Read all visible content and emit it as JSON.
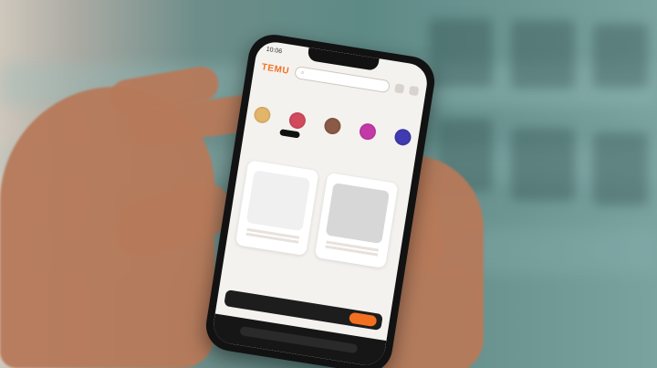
{
  "phone": {
    "status_time": "10:06",
    "header": {
      "logo_text": "TEMU",
      "search_placeholder": "",
      "icons": [
        "search-icon",
        "user-icon",
        "cart-icon"
      ]
    },
    "tabs": [],
    "subline": "",
    "category_row": [],
    "cta": {
      "text": ""
    }
  },
  "colors": {
    "brand_orange": "#f37021",
    "bg_teal": "#5e8a86",
    "skin": "#b77a5a"
  }
}
